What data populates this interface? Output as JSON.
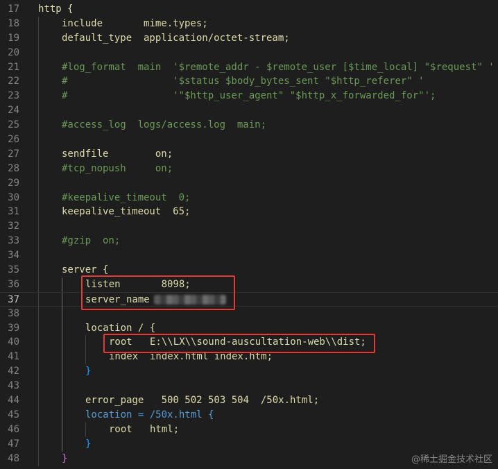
{
  "lines": [
    {
      "no": "17",
      "text": "http {"
    },
    {
      "no": "18",
      "text": "include       mime.types;"
    },
    {
      "no": "19",
      "text": "default_type  application/octet-stream;"
    },
    {
      "no": "20",
      "text": ""
    },
    {
      "no": "21",
      "text": "#log_format  main  '$remote_addr - $remote_user [$time_local] \"$request\" '"
    },
    {
      "no": "22",
      "text": "#                  '$status $body_bytes_sent \"$http_referer\" '"
    },
    {
      "no": "23",
      "text": "#                  '\"$http_user_agent\" \"$http_x_forwarded_for\"';"
    },
    {
      "no": "24",
      "text": ""
    },
    {
      "no": "25",
      "text": "#access_log  logs/access.log  main;"
    },
    {
      "no": "26",
      "text": ""
    },
    {
      "no": "27",
      "text": "sendfile        on;"
    },
    {
      "no": "28",
      "text": "#tcp_nopush     on;"
    },
    {
      "no": "29",
      "text": ""
    },
    {
      "no": "30",
      "text": "#keepalive_timeout  0;"
    },
    {
      "no": "31",
      "text": "keepalive_timeout  65;"
    },
    {
      "no": "32",
      "text": ""
    },
    {
      "no": "33",
      "text": "#gzip  on;"
    },
    {
      "no": "34",
      "text": ""
    },
    {
      "no": "35",
      "text": "server {"
    },
    {
      "no": "36",
      "text": "listen       8098;"
    },
    {
      "no": "37",
      "text": "server_name"
    },
    {
      "no": "38",
      "text": ""
    },
    {
      "no": "39",
      "text": "location / {"
    },
    {
      "no": "40",
      "text": "root   E:\\\\LX\\\\sound-auscultation-web\\\\dist;"
    },
    {
      "no": "41",
      "text": "index  index.html index.htm;"
    },
    {
      "no": "42",
      "text": "}"
    },
    {
      "no": "43",
      "text": ""
    },
    {
      "no": "44",
      "text": "error_page   500 502 503 504  /50x.html;"
    },
    {
      "no": "45",
      "text": "location = /50x.html {"
    },
    {
      "no": "46",
      "text": "root   html;"
    },
    {
      "no": "47",
      "text": "}"
    },
    {
      "no": "48",
      "text": "}"
    }
  ],
  "watermark": "@稀土掘金技术社区"
}
